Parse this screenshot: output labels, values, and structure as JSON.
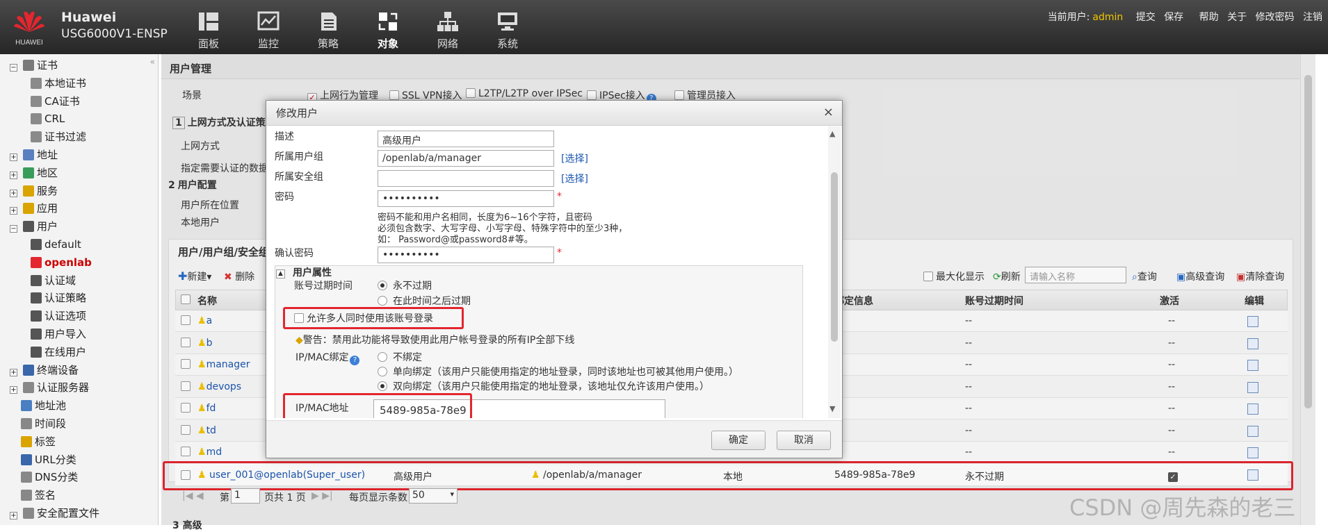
{
  "app": {
    "brand_line1": "Huawei",
    "brand_line2": "USG6000V1-ENSP",
    "logo_text": "HUAWEI"
  },
  "nav": [
    {
      "label": "面板",
      "icon": "dashboard-icon"
    },
    {
      "label": "监控",
      "icon": "monitor-icon"
    },
    {
      "label": "策略",
      "icon": "policy-icon"
    },
    {
      "label": "对象",
      "icon": "object-icon"
    },
    {
      "label": "网络",
      "icon": "network-icon"
    },
    {
      "label": "系统",
      "icon": "system-icon"
    }
  ],
  "userbar": {
    "current_label": "当前用户:",
    "user": "admin",
    "submit": "提交",
    "save": "保存",
    "help": "帮助",
    "about": "关于",
    "change_pwd": "修改密码",
    "logout": "注销"
  },
  "sidebar": {
    "items": [
      {
        "label": "证书",
        "exp": "−"
      },
      {
        "label": "本地证书"
      },
      {
        "label": "CA证书"
      },
      {
        "label": "CRL"
      },
      {
        "label": "证书过滤"
      },
      {
        "label": "地址",
        "exp": "+"
      },
      {
        "label": "地区",
        "exp": "+"
      },
      {
        "label": "服务",
        "exp": "+"
      },
      {
        "label": "应用",
        "exp": "+"
      },
      {
        "label": "用户",
        "exp": "−"
      },
      {
        "label": "default"
      },
      {
        "label": "openlab"
      },
      {
        "label": "认证域"
      },
      {
        "label": "认证策略"
      },
      {
        "label": "认证选项"
      },
      {
        "label": "用户导入"
      },
      {
        "label": "在线用户"
      },
      {
        "label": "终端设备",
        "exp": "+"
      },
      {
        "label": "认证服务器",
        "exp": "+"
      },
      {
        "label": "地址池"
      },
      {
        "label": "时间段"
      },
      {
        "label": "标签"
      },
      {
        "label": "URL分类"
      },
      {
        "label": "DNS分类"
      },
      {
        "label": "签名"
      },
      {
        "label": "安全配置文件",
        "exp": "+"
      }
    ]
  },
  "main": {
    "title": "用户管理",
    "scene_label": "场景",
    "scenes": [
      "上网行为管理",
      "SSL VPN接入",
      "L2TP/L2TP over IPSec",
      "IPSec接入",
      "管理员接入"
    ],
    "section1": "上网方式及认证策略",
    "access_mode": "上网方式",
    "specify_data": "指定需要认证的数据",
    "section2": "用户配置",
    "user_location": "用户所在位置",
    "local_user": "本地用户",
    "list_title": "用户/用户组/安全组",
    "new_btn": "新建",
    "delete_btn": "删除",
    "maximize": "最大化显示",
    "refresh": "刷新",
    "search_placeholder": "请输入名称",
    "query": "查询",
    "adv_query": "高级查询",
    "clear_query": "清除查询",
    "columns": {
      "name": "名称",
      "bind": "绑定信息",
      "expire": "账号过期时间",
      "active": "激活",
      "edit": "编辑"
    },
    "rows": [
      {
        "name": "a",
        "expire": "--",
        "active": "--"
      },
      {
        "name": "b",
        "expire": "--",
        "active": "--"
      },
      {
        "name": "manager",
        "expire": "--",
        "active": "--"
      },
      {
        "name": "devops",
        "expire": "--",
        "active": "--"
      },
      {
        "name": "fd",
        "expire": "--",
        "active": "--"
      },
      {
        "name": "td",
        "expire": "--",
        "active": "--"
      },
      {
        "name": "md",
        "expire": "--",
        "active": "--"
      }
    ],
    "highlight_row": {
      "name": "user_001@openlab(Super_user)",
      "desc": "高级用户",
      "group": "/openlab/a/manager",
      "location": "本地",
      "bind": "5489-985a-78e9",
      "expire": "永不过期"
    },
    "pager": {
      "page_prefix": "第",
      "page": "1",
      "total": "页共 1 页",
      "per_page_label": "每页显示条数",
      "per_page": "50"
    },
    "bottom_section": "3 高级"
  },
  "modal": {
    "title": "修改用户",
    "close": "×",
    "desc_label": "描述",
    "desc_value": "高级用户",
    "group_label": "所属用户组",
    "group_value": "/openlab/a/manager",
    "select": "[选择]",
    "secgroup_label": "所属安全组",
    "secgroup_value": "",
    "pwd_label": "密码",
    "pwd_value": "••••••••••",
    "required": "*",
    "pwd_hint1": "密码不能和用户名相同，长度为6~16个字符，且密码",
    "pwd_hint2": "必须包含数字、大写字母、小写字母、特殊字符中的至少3种，",
    "pwd_hint3": "如： Password@或password8#等。",
    "confirm_label": "确认密码",
    "confirm_value": "••••••••••",
    "attr_title": "用户属性",
    "expire_label": "账号过期时间",
    "never_expire": "永不过期",
    "expire_after": "在此时间之后过期",
    "multi_login": "允许多人同时使用该账号登录",
    "warning": "警告：禁用此功能将导致使用此用户帐号登录的所有IP全部下线",
    "ipmac_label": "IP/MAC绑定",
    "bind_none": "不绑定",
    "bind_one": "单向绑定（该用户只能使用指定的地址登录，同时该地址也可被其他用户使用。）",
    "bind_two": "双向绑定（该用户只能使用指定的地址登录，该地址仅允许该用户使用。）",
    "ipmac_addr_label": "IP/MAC地址",
    "ipmac_addr_value": "5489-985a-78e9",
    "ok": "确定",
    "cancel": "取消"
  },
  "watermark": "CSDN @周先森的老三",
  "colors": {
    "highlight": "#e3262f",
    "link": "#1b56b0",
    "user_yellow": "#f2c500"
  }
}
